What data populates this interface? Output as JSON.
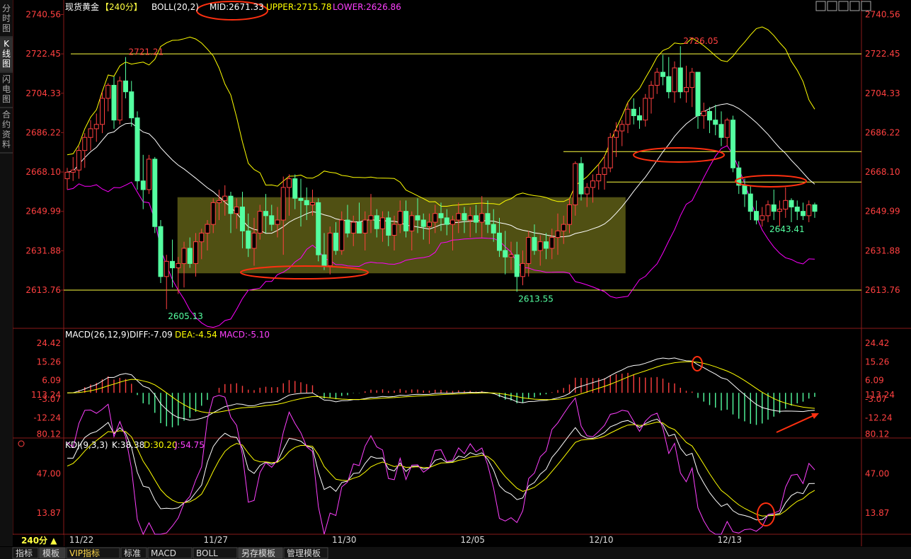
{
  "sidebar": {
    "tabs": [
      "分时图",
      "K线图",
      "闪电图",
      "合约资料"
    ],
    "active": 1
  },
  "header": {
    "instrument": "现货黄金",
    "period": "【240分】",
    "indicator": "BOLL(20,2)",
    "mid": "MID:2671.33",
    "upper": "UPPER:2715.78",
    "lower": "LOWER:2626.86"
  },
  "toolbar_icons": [
    "grid-icon",
    "window-icon",
    "restore-icon",
    "maximize-icon",
    "close-icon"
  ],
  "price_axis": {
    "labels": [
      "2740.56",
      "2722.45",
      "2704.33",
      "2686.22",
      "2668.10",
      "2649.99",
      "2631.88",
      "2613.76"
    ],
    "range": [
      2613.76,
      2740.56
    ]
  },
  "macd_axis": {
    "labels": [
      "24.42",
      "15.26",
      "6.09",
      "-3.07",
      "-12.24"
    ]
  },
  "kdj_axis": {
    "labels": [
      "113.24",
      "80.12",
      "47.00",
      "13.87"
    ]
  },
  "macd_header": {
    "name": "MACD(26,12,9)",
    "diff": "DIFF:-7.09",
    "dea": "DEA:-4.54",
    "macd": "MACD:-5.10"
  },
  "kdj_header": {
    "name": "KDJ(9,3,3)",
    "k": "K:38.38",
    "d": "D:30.20",
    "j": "J:54.75"
  },
  "price_annotations": [
    {
      "text": "2721.21",
      "candle": 10,
      "pos": "above"
    },
    {
      "text": "2605.13",
      "candle": 17,
      "pos": "below"
    },
    {
      "text": "2613.55",
      "candle": 77,
      "pos": "below"
    },
    {
      "text": "2726.05",
      "candle": 105,
      "pos": "above"
    },
    {
      "text": "2643.41",
      "candle": 120,
      "pos": "below"
    }
  ],
  "date_labels": [
    "11/22",
    "11/27",
    "11/30",
    "12/05",
    "12/10",
    "12/13"
  ],
  "period_label": "240分 ▲",
  "bottom_tabs": [
    "指标",
    "模板",
    "VIP指标",
    "标准",
    "MACD",
    "BOLL",
    "另存模板",
    "管理模板"
  ],
  "colors": {
    "up": "#ff4040",
    "down": "#54ffa0",
    "mid_line": "#ffffff",
    "upper_line": "#ffff00",
    "lower_line": "#ff00ff",
    "axis_text": "#ff4040",
    "box_fill": "#6b6b1a",
    "highlight": "#ff3010"
  },
  "chart_data": [
    {
      "type": "candlestick",
      "title": "现货黄金 240分",
      "ylim": [
        2600,
        2745
      ],
      "candles": [
        [
          2665,
          2670,
          2660,
          2668
        ],
        [
          2668,
          2675,
          2664,
          2669
        ],
        [
          2669,
          2680,
          2665,
          2678
        ],
        [
          2678,
          2686,
          2670,
          2684
        ],
        [
          2684,
          2692,
          2678,
          2688
        ],
        [
          2688,
          2695,
          2682,
          2690
        ],
        [
          2690,
          2705,
          2686,
          2702
        ],
        [
          2702,
          2709,
          2696,
          2708
        ],
        [
          2708,
          2712,
          2688,
          2692
        ],
        [
          2692,
          2712,
          2690,
          2710
        ],
        [
          2710,
          2721,
          2702,
          2705
        ],
        [
          2705,
          2710,
          2689,
          2693
        ],
        [
          2693,
          2696,
          2660,
          2664
        ],
        [
          2664,
          2676,
          2651,
          2660
        ],
        [
          2660,
          2676,
          2658,
          2674
        ],
        [
          2674,
          2675,
          2640,
          2643
        ],
        [
          2643,
          2646,
          2617,
          2620
        ],
        [
          2620,
          2630,
          2605,
          2627
        ],
        [
          2627,
          2637,
          2615,
          2624
        ],
        [
          2624,
          2629,
          2612,
          2626
        ],
        [
          2626,
          2636,
          2615,
          2633
        ],
        [
          2633,
          2638,
          2624,
          2626
        ],
        [
          2626,
          2640,
          2620,
          2636
        ],
        [
          2636,
          2642,
          2628,
          2640
        ],
        [
          2640,
          2646,
          2632,
          2644
        ],
        [
          2644,
          2656,
          2640,
          2654
        ],
        [
          2654,
          2660,
          2646,
          2655
        ],
        [
          2655,
          2662,
          2648,
          2657
        ],
        [
          2657,
          2659,
          2640,
          2649
        ],
        [
          2649,
          2656,
          2642,
          2652
        ],
        [
          2652,
          2659,
          2633,
          2641
        ],
        [
          2641,
          2649,
          2629,
          2633
        ],
        [
          2633,
          2647,
          2625,
          2640
        ],
        [
          2640,
          2653,
          2637,
          2650
        ],
        [
          2650,
          2658,
          2640,
          2648
        ],
        [
          2648,
          2653,
          2641,
          2644
        ],
        [
          2644,
          2652,
          2638,
          2646
        ],
        [
          2646,
          2666,
          2630,
          2661
        ],
        [
          2661,
          2667,
          2648,
          2665
        ],
        [
          2665,
          2667,
          2651,
          2656
        ],
        [
          2656,
          2665,
          2643,
          2655
        ],
        [
          2655,
          2661,
          2646,
          2653
        ],
        [
          2653,
          2660,
          2648,
          2654
        ],
        [
          2654,
          2656,
          2627,
          2630
        ],
        [
          2630,
          2640,
          2623,
          2625
        ],
        [
          2625,
          2643,
          2621,
          2640
        ],
        [
          2640,
          2645,
          2630,
          2632
        ],
        [
          2632,
          2650,
          2630,
          2646
        ],
        [
          2646,
          2653,
          2638,
          2640
        ],
        [
          2640,
          2648,
          2634,
          2645
        ],
        [
          2645,
          2654,
          2640,
          2640
        ],
        [
          2640,
          2650,
          2632,
          2646
        ],
        [
          2646,
          2658,
          2640,
          2648
        ],
        [
          2648,
          2651,
          2638,
          2642
        ],
        [
          2642,
          2650,
          2636,
          2647
        ],
        [
          2647,
          2650,
          2634,
          2639
        ],
        [
          2639,
          2648,
          2632,
          2644
        ],
        [
          2644,
          2655,
          2640,
          2650
        ],
        [
          2650,
          2655,
          2638,
          2641
        ],
        [
          2641,
          2650,
          2632,
          2648
        ],
        [
          2648,
          2656,
          2640,
          2646
        ],
        [
          2646,
          2649,
          2637,
          2643
        ],
        [
          2643,
          2649,
          2635,
          2645
        ],
        [
          2645,
          2653,
          2640,
          2649
        ],
        [
          2649,
          2654,
          2641,
          2647
        ],
        [
          2647,
          2651,
          2639,
          2644
        ],
        [
          2644,
          2648,
          2632,
          2646
        ],
        [
          2646,
          2654,
          2640,
          2649
        ],
        [
          2649,
          2652,
          2640,
          2646
        ],
        [
          2646,
          2652,
          2638,
          2648
        ],
        [
          2648,
          2653,
          2640,
          2645
        ],
        [
          2645,
          2657,
          2638,
          2649
        ],
        [
          2649,
          2655,
          2640,
          2644
        ],
        [
          2644,
          2651,
          2636,
          2640
        ],
        [
          2640,
          2647,
          2629,
          2632
        ],
        [
          2632,
          2641,
          2621,
          2629
        ],
        [
          2629,
          2636,
          2623,
          2630
        ],
        [
          2630,
          2636,
          2613,
          2620
        ],
        [
          2620,
          2632,
          2616,
          2626
        ],
        [
          2626,
          2641,
          2620,
          2638
        ],
        [
          2638,
          2644,
          2630,
          2632
        ],
        [
          2632,
          2639,
          2625,
          2636
        ],
        [
          2636,
          2640,
          2628,
          2633
        ],
        [
          2633,
          2642,
          2628,
          2638
        ],
        [
          2638,
          2649,
          2630,
          2641
        ],
        [
          2641,
          2648,
          2635,
          2644
        ],
        [
          2644,
          2656,
          2640,
          2653
        ],
        [
          2653,
          2673,
          2648,
          2672
        ],
        [
          2672,
          2675,
          2655,
          2658
        ],
        [
          2658,
          2663,
          2652,
          2661
        ],
        [
          2661,
          2667,
          2654,
          2664
        ],
        [
          2664,
          2672,
          2660,
          2667
        ],
        [
          2667,
          2676,
          2660,
          2670
        ],
        [
          2670,
          2686,
          2668,
          2684
        ],
        [
          2684,
          2691,
          2675,
          2687
        ],
        [
          2687,
          2692,
          2680,
          2690
        ],
        [
          2690,
          2700,
          2686,
          2697
        ],
        [
          2697,
          2702,
          2690,
          2694
        ],
        [
          2694,
          2698,
          2688,
          2692
        ],
        [
          2692,
          2704,
          2689,
          2702
        ],
        [
          2702,
          2710,
          2695,
          2708
        ],
        [
          2708,
          2716,
          2704,
          2714
        ],
        [
          2714,
          2722,
          2708,
          2712
        ],
        [
          2712,
          2721,
          2702,
          2705
        ],
        [
          2705,
          2719,
          2700,
          2716
        ],
        [
          2716,
          2726,
          2702,
          2705
        ],
        [
          2705,
          2717,
          2700,
          2707
        ],
        [
          2707,
          2716,
          2698,
          2714
        ],
        [
          2714,
          2714,
          2688,
          2694
        ],
        [
          2694,
          2700,
          2688,
          2696
        ],
        [
          2696,
          2698,
          2686,
          2692
        ],
        [
          2692,
          2699,
          2685,
          2690
        ],
        [
          2690,
          2696,
          2680,
          2684
        ],
        [
          2684,
          2693,
          2680,
          2692
        ],
        [
          2692,
          2694,
          2668,
          2670
        ],
        [
          2670,
          2673,
          2658,
          2662
        ],
        [
          2662,
          2665,
          2652,
          2658
        ],
        [
          2658,
          2662,
          2646,
          2650
        ],
        [
          2650,
          2655,
          2644,
          2646
        ],
        [
          2646,
          2652,
          2643,
          2648
        ],
        [
          2648,
          2655,
          2645,
          2653
        ],
        [
          2653,
          2660,
          2646,
          2650
        ],
        [
          2650,
          2655,
          2643,
          2651
        ],
        [
          2651,
          2661,
          2647,
          2655
        ],
        [
          2655,
          2656,
          2645,
          2652
        ],
        [
          2652,
          2655,
          2646,
          2650
        ],
        [
          2650,
          2654,
          2646,
          2648
        ],
        [
          2648,
          2655,
          2645,
          2653
        ],
        [
          2653,
          2654,
          2647,
          2650
        ]
      ],
      "boll": {
        "mid": "MID",
        "upper": "UPPER",
        "lower": "LOWER"
      },
      "horizontal_lines": [
        2722.45,
        2613.76,
        2677.5,
        2663.5
      ],
      "consolidation_zone": {
        "candle_from": 19,
        "candle_to": 95,
        "price_top": 2656.5,
        "price_bottom": 2621.5
      }
    },
    {
      "type": "bar",
      "title": "MACD(26,12,9)",
      "ylim": [
        -18,
        28
      ],
      "y_ticks": [
        24.42,
        15.26,
        6.09,
        -3.07,
        -12.24
      ]
    },
    {
      "type": "line",
      "title": "KDJ(9,3,3)",
      "ylim": [
        -5,
        120
      ],
      "y_ticks": [
        113.24,
        80.12,
        47.0,
        13.87
      ]
    }
  ]
}
